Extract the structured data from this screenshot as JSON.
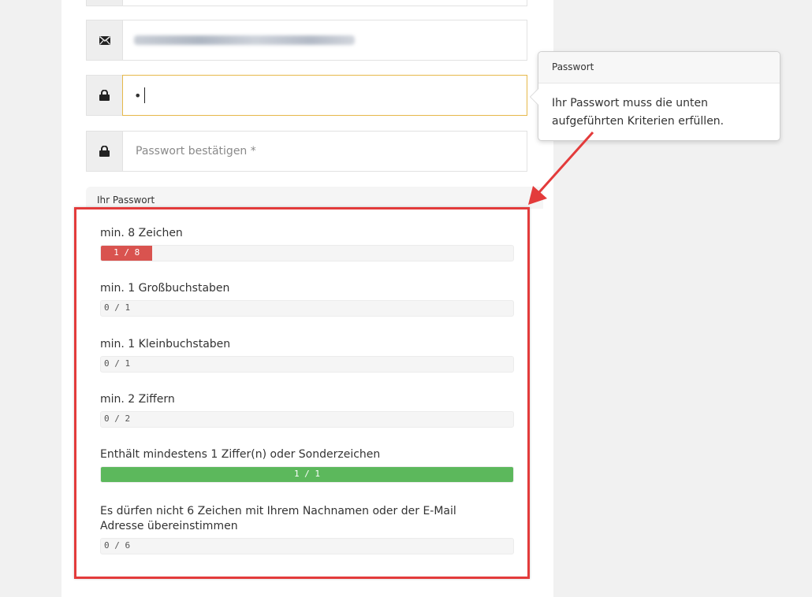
{
  "form": {
    "email_field": {
      "icon": "envelope-icon",
      "value_blurred": true
    },
    "password_field": {
      "icon": "lock-icon",
      "value": "•"
    },
    "confirm_field": {
      "icon": "lock-icon",
      "placeholder": "Passwort bestätigen *"
    }
  },
  "popover": {
    "title": "Passwort",
    "body_line1": "Ihr Passwort muss die unten",
    "body_line2": "aufgeführten Kriterien erfüllen."
  },
  "password_panel": {
    "header": "Ihr Passwort",
    "criteria": [
      {
        "label": "min. 8 Zeichen",
        "progress_text": "1 / 8",
        "current": 1,
        "total": 8,
        "status_color": "#d9534f"
      },
      {
        "label": "min. 1 Großbuchstaben",
        "progress_text": "0 / 1",
        "current": 0,
        "total": 1,
        "status_color": "#d9534f"
      },
      {
        "label": "min. 1 Kleinbuchstaben",
        "progress_text": "0 / 1",
        "current": 0,
        "total": 1,
        "status_color": "#d9534f"
      },
      {
        "label": "min. 2 Ziffern",
        "progress_text": "0 / 2",
        "current": 0,
        "total": 2,
        "status_color": "#d9534f"
      },
      {
        "label": "Enthält mindestens 1 Ziffer(n) oder Sonderzeichen",
        "progress_text": "1 / 1",
        "current": 1,
        "total": 1,
        "status_color": "#5cb85c"
      },
      {
        "label_line1": "Es dürfen nicht 6 Zeichen mit Ihrem Nachnamen oder der E-Mail",
        "label_line2": "Adresse übereinstimmen",
        "progress_text": "0 / 6",
        "current": 0,
        "total": 6,
        "status_color": "#d9534f"
      }
    ]
  },
  "colors": {
    "annotation_red": "#e33b3b",
    "focus_border": "#e6b84a"
  }
}
